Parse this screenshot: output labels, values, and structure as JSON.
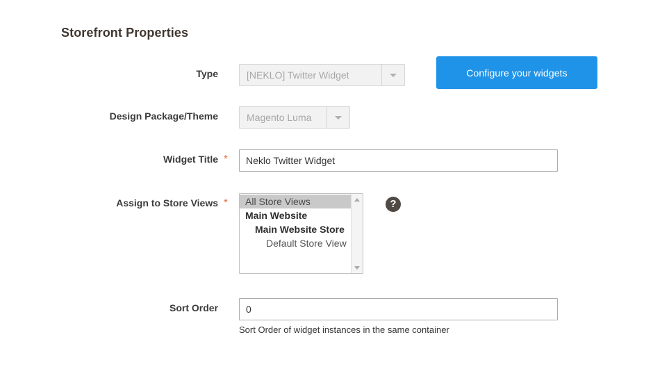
{
  "section": {
    "title": "Storefront Properties"
  },
  "fields": {
    "type": {
      "label": "Type",
      "value": "[NEKLO] Twitter Widget",
      "disabled": true,
      "arrow_icon": "chevron-down-icon"
    },
    "design_theme": {
      "label": "Design Package/Theme",
      "value": "Magento Luma",
      "disabled": true,
      "arrow_icon": "chevron-down-icon"
    },
    "widget_title": {
      "label": "Widget Title",
      "required_marker": "*",
      "value": "Neklo Twitter Widget",
      "placeholder": ""
    },
    "assign_store_views": {
      "label": "Assign to Store Views",
      "required_marker": "*",
      "options": [
        {
          "label": "All Store Views",
          "level": 0,
          "bold": false,
          "selected": true
        },
        {
          "label": "Main Website",
          "level": 0,
          "bold": true,
          "selected": false
        },
        {
          "label": "Main Website Store",
          "level": 1,
          "bold": true,
          "selected": false
        },
        {
          "label": "Default Store View",
          "level": 2,
          "bold": false,
          "selected": false
        }
      ],
      "help_icon": "question-mark-icon",
      "scroll_up_icon": "scroll-up-arrow-icon",
      "scroll_down_icon": "scroll-down-arrow-icon"
    },
    "sort_order": {
      "label": "Sort Order",
      "value": "0",
      "placeholder": "",
      "note": "Sort Order of widget instances in the same container"
    }
  },
  "buttons": {
    "configure_widgets": "Configure your widgets"
  },
  "colors": {
    "accent_blue": "#1f93e8",
    "required_star": "#e06e3a",
    "title_text": "#41362f",
    "help_icon_bg": "#514943",
    "selected_option_bg": "#c9c9c9",
    "disabled_field_bg": "#f2f2f2"
  }
}
